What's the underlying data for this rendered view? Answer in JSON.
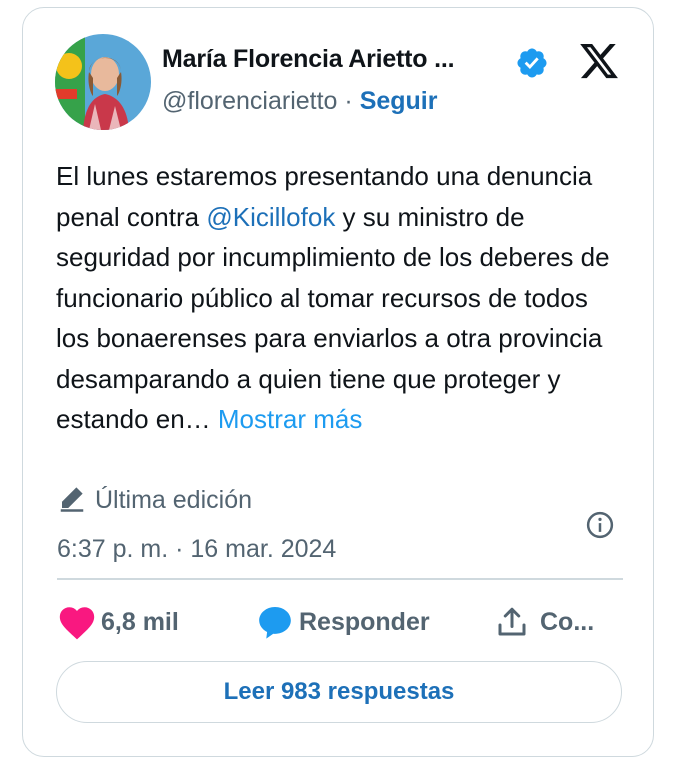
{
  "tweet": {
    "author_name": "María Florencia Arietto ...",
    "handle": "@florenciarietto",
    "separator": "·",
    "follow_label": "Seguir",
    "text_before_mention": "El lunes estaremos presentando una denuncia penal contra ",
    "mention": "@Kicillofok",
    "text_after_mention": " y su ministro de seguridad por incumplimiento de los deberes de funcionario público al tomar recursos de todos los bonaerenses para enviarlos a otra provincia desamparando a quien tiene que proteger y estando en… ",
    "show_more": "Mostrar más",
    "edited_label": "Última edición",
    "timestamp": "6:37 p. m. · 16 mar. 2024"
  },
  "actions": {
    "likes_count": "6,8 mil",
    "reply_label": "Responder",
    "share_label": "Co..."
  },
  "read_replies_label": "Leer 983 respuestas",
  "icons": [
    "avatar",
    "verified-badge-icon",
    "x-logo-icon",
    "pencil-icon",
    "info-icon",
    "heart-icon",
    "reply-bubble-icon",
    "share-icon"
  ],
  "colors": {
    "link": "#1d70b8",
    "show_more": "#1d9bf0",
    "verified": "#1d9bf0",
    "heart": "#f91880",
    "reply_bubble": "#1d9bf0",
    "muted": "#536471",
    "border": "#cfd9de"
  }
}
